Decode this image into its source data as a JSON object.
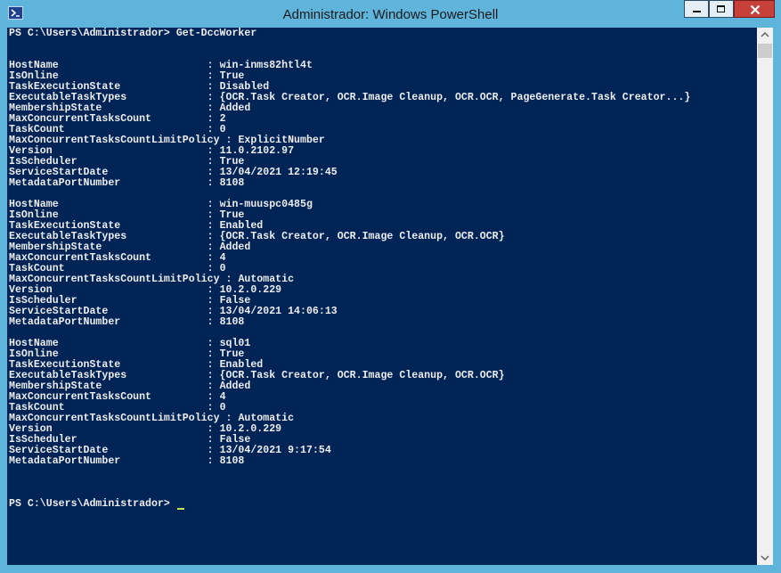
{
  "window": {
    "title": "Administrador: Windows PowerShell"
  },
  "console": {
    "command_line": "PS C:\\Users\\Administrador> Get-DccWorker",
    "workers": [
      {
        "HostName": "win-inms82htl4t",
        "IsOnline": "True",
        "TaskExecutionState": "Disabled",
        "ExecutableTaskTypes": "{OCR.Task Creator, OCR.Image Cleanup, OCR.OCR, PageGenerate.Task Creator...}",
        "MembershipState": "Added",
        "MaxConcurrentTasksCount": "2",
        "TaskCount": "0",
        "MaxConcurrentTasksCountLimitPolicy": "ExplicitNumber",
        "Version": "11.0.2102.97",
        "IsScheduler": "True",
        "ServiceStartDate": "13/04/2021 12:19:45",
        "MetadataPortNumber": "8108"
      },
      {
        "HostName": "win-muuspc0485g",
        "IsOnline": "True",
        "TaskExecutionState": "Enabled",
        "ExecutableTaskTypes": "{OCR.Task Creator, OCR.Image Cleanup, OCR.OCR}",
        "MembershipState": "Added",
        "MaxConcurrentTasksCount": "4",
        "TaskCount": "0",
        "MaxConcurrentTasksCountLimitPolicy": "Automatic",
        "Version": "10.2.0.229",
        "IsScheduler": "False",
        "ServiceStartDate": "13/04/2021 14:06:13",
        "MetadataPortNumber": "8108"
      },
      {
        "HostName": "sql01",
        "IsOnline": "True",
        "TaskExecutionState": "Enabled",
        "ExecutableTaskTypes": "{OCR.Task Creator, OCR.Image Cleanup, OCR.OCR}",
        "MembershipState": "Added",
        "MaxConcurrentTasksCount": "4",
        "TaskCount": "0",
        "MaxConcurrentTasksCountLimitPolicy": "Automatic",
        "Version": "10.2.0.229",
        "IsScheduler": "False",
        "ServiceStartDate": "13/04/2021 9:17:54",
        "MetadataPortNumber": "8108"
      }
    ],
    "prompt": "PS C:\\Users\\Administrador> "
  }
}
